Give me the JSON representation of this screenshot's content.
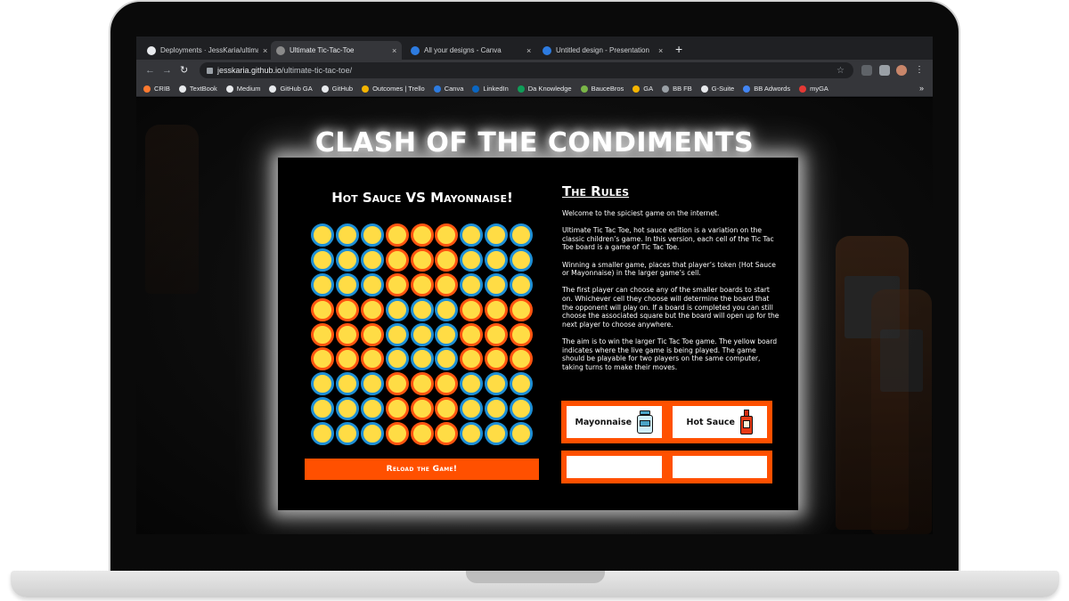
{
  "browser": {
    "tabs": [
      {
        "title": "Deployments · JessKaria/ultimate-tic-tac-toe",
        "favicon_color": "#e8eaed",
        "favicon": "github-icon",
        "active": false
      },
      {
        "title": "Ultimate Tic-Tac-Toe",
        "favicon_color": "#8a8a8a",
        "favicon": "globe-icon",
        "active": true
      },
      {
        "title": "All your designs - Canva",
        "favicon_color": "#2d7be0",
        "favicon": "canva-icon",
        "active": false
      },
      {
        "title": "Untitled design - Presentation",
        "favicon_color": "#2d7be0",
        "favicon": "canva-icon",
        "active": false
      }
    ],
    "close_glyph": "×",
    "new_tab_glyph": "+",
    "back_glyph": "←",
    "forward_glyph": "→",
    "reload_glyph": "↻",
    "url_host": "jesskaria.github.io",
    "url_path": "/ultimate-tic-tac-toe/",
    "bookmark_star_glyph": "☆",
    "bookmarks": [
      {
        "label": "CRIB",
        "color": "#ff7a30"
      },
      {
        "label": "TextBook",
        "color": "#e8eaed"
      },
      {
        "label": "Medium",
        "color": "#e8eaed"
      },
      {
        "label": "GitHub GA",
        "color": "#e8eaed"
      },
      {
        "label": "GitHub",
        "color": "#e8eaed"
      },
      {
        "label": "Outcomes | Trello",
        "color": "#f4b400"
      },
      {
        "label": "Canva",
        "color": "#2d7be0"
      },
      {
        "label": "LinkedIn",
        "color": "#0a66c2"
      },
      {
        "label": "Da Knowledge",
        "color": "#0f9d58"
      },
      {
        "label": "BauceBros",
        "color": "#7ab648"
      },
      {
        "label": "GA",
        "color": "#f4b400"
      },
      {
        "label": "BB FB",
        "color": "#9aa0a6"
      },
      {
        "label": "G-Suite",
        "color": "#e8eaed"
      },
      {
        "label": "BB Adwords",
        "color": "#4285f4"
      },
      {
        "label": "myGA",
        "color": "#e53935"
      }
    ],
    "bookmarks_more": "»"
  },
  "page": {
    "title": "CLASH OF THE CONDIMENTS",
    "game_heading": "Hot Sauce VS Mayonnaise!",
    "reload_button": "Reload the Game!",
    "rules_heading": "The Rules",
    "rules_paragraphs": [
      "Welcome to the spiciest game on the internet.",
      "Ultimate Tic Tac Toe, hot sauce edition is a variation on the classic children’s game. In this version, each cell of the Tic Tac Toe board is a game of Tic Tac Toe.",
      "Winning a smaller game, places that player’s token (Hot Sauce or Mayonnaise) in the larger game’s cell.",
      "The first player can choose any of the smaller boards to start on. Whichever cell they choose will determine the board that the opponent will play on. If a board is completed you can still choose the associated square but the board will open up for the next player to choose anywhere.",
      "The aim is to win the larger Tic Tac Toe game. The yellow board indicates where the live game is being played. The game should be playable for two players on the same computer, taking turns to make their moves."
    ],
    "player_tokens": [
      {
        "label": "Mayonnaise",
        "icon": "mayonnaise-jar-icon"
      },
      {
        "label": "Hot Sauce",
        "icon": "hot-sauce-bottle-icon"
      }
    ]
  },
  "colors": {
    "blue_ring": "#1e8fd6",
    "orange_ring": "#ff5410",
    "cell_fill": "#ffdc45",
    "accent": "#ff5000"
  }
}
